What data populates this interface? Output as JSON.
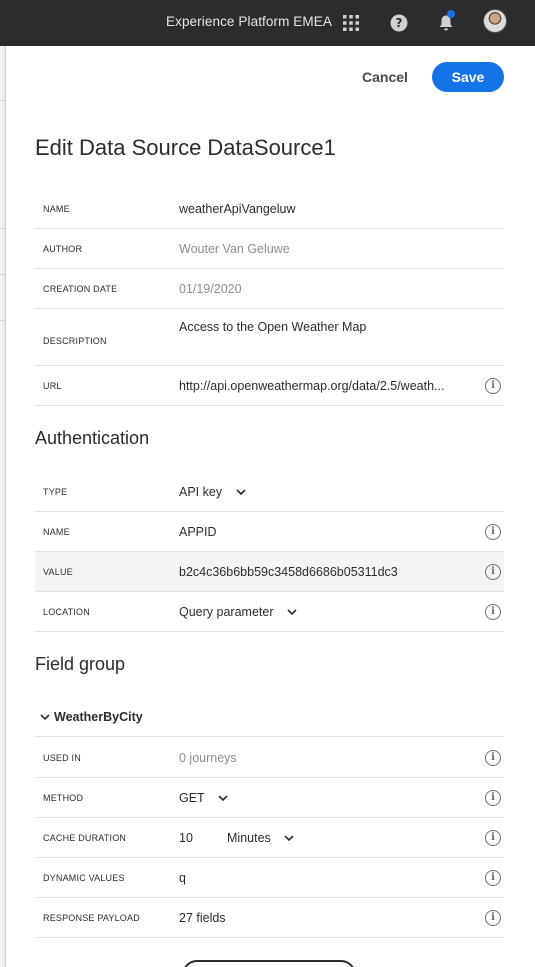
{
  "topbar": {
    "org_name": "Experience Platform EMEA",
    "icons": [
      "apps-grid-icon",
      "help-icon",
      "notifications-bell-icon",
      "user-avatar"
    ]
  },
  "actions": {
    "cancel_label": "Cancel",
    "save_label": "Save"
  },
  "page_title": "Edit Data Source DataSource1",
  "details": [
    {
      "label": "NAME",
      "value": "weatherApiVangeluw"
    },
    {
      "label": "AUTHOR",
      "value": "Wouter Van Geluwe"
    },
    {
      "label": "CREATION DATE",
      "value": "01/19/2020"
    },
    {
      "label": "DESCRIPTION",
      "value": "Access to the Open Weather Map"
    },
    {
      "label": "URL",
      "value": "http://api.openweathermap.org/data/2.5/weath..."
    }
  ],
  "authentication": {
    "title": "Authentication",
    "rows": [
      {
        "label": "TYPE",
        "value": "API key"
      },
      {
        "label": "NAME",
        "value": "APPID"
      },
      {
        "label": "VALUE",
        "value": "b2c4c36b6bb59c3458d6686b05311dc3"
      },
      {
        "label": "LOCATION",
        "value": "Query parameter"
      }
    ]
  },
  "field_group": {
    "title": "Field group",
    "group_name": "WeatherByCity",
    "rows": [
      {
        "label": "USED IN",
        "value": "0 journeys"
      },
      {
        "label": "METHOD",
        "value": "GET"
      },
      {
        "label": "CACHE DURATION",
        "value": "10",
        "unit": "Minutes"
      },
      {
        "label": "DYNAMIC VALUES",
        "value": "q"
      },
      {
        "label": "RESPONSE PAYLOAD",
        "value": "27 fields"
      }
    ]
  },
  "colors": {
    "accent": "#1473e6",
    "topbar": "#2c2c2c",
    "muted_text": "#8e8e8e"
  }
}
